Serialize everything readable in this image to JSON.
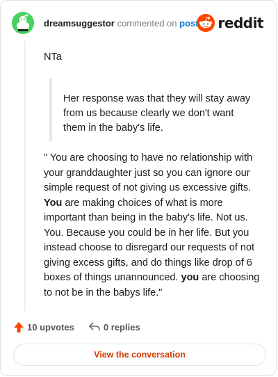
{
  "header": {
    "username": "dreamsuggestor",
    "verb": "commented on",
    "post_link": "post",
    "brand_name": "reddit"
  },
  "comment": {
    "first_line": "NTa",
    "quote": "Her response was that they will stay away from us because clearly we don't want them in the baby's life.",
    "para_1": "\" You are choosing to have no relationship with your granddaughter just so you can ignore our simple request of not giving us excessive gifts. ",
    "para_bold_1": "You",
    "para_2": " are making choices of what is more important than being in the baby's life. Not us. You. Because you could be in her life. But you instead choose to disregard our requests of not giving excess gifts, and do things like drop of 6 boxes of things unannounced. ",
    "para_bold_2": "you",
    "para_3": " are choosing to not be in the babys life.\""
  },
  "footer": {
    "upvotes": "10 upvotes",
    "replies": "0 replies"
  },
  "cta": {
    "label": "View the conversation"
  },
  "colors": {
    "accent": "#d93a00",
    "upvote": "#ff4500",
    "avatar": "#46d160",
    "link": "#0079d3"
  }
}
